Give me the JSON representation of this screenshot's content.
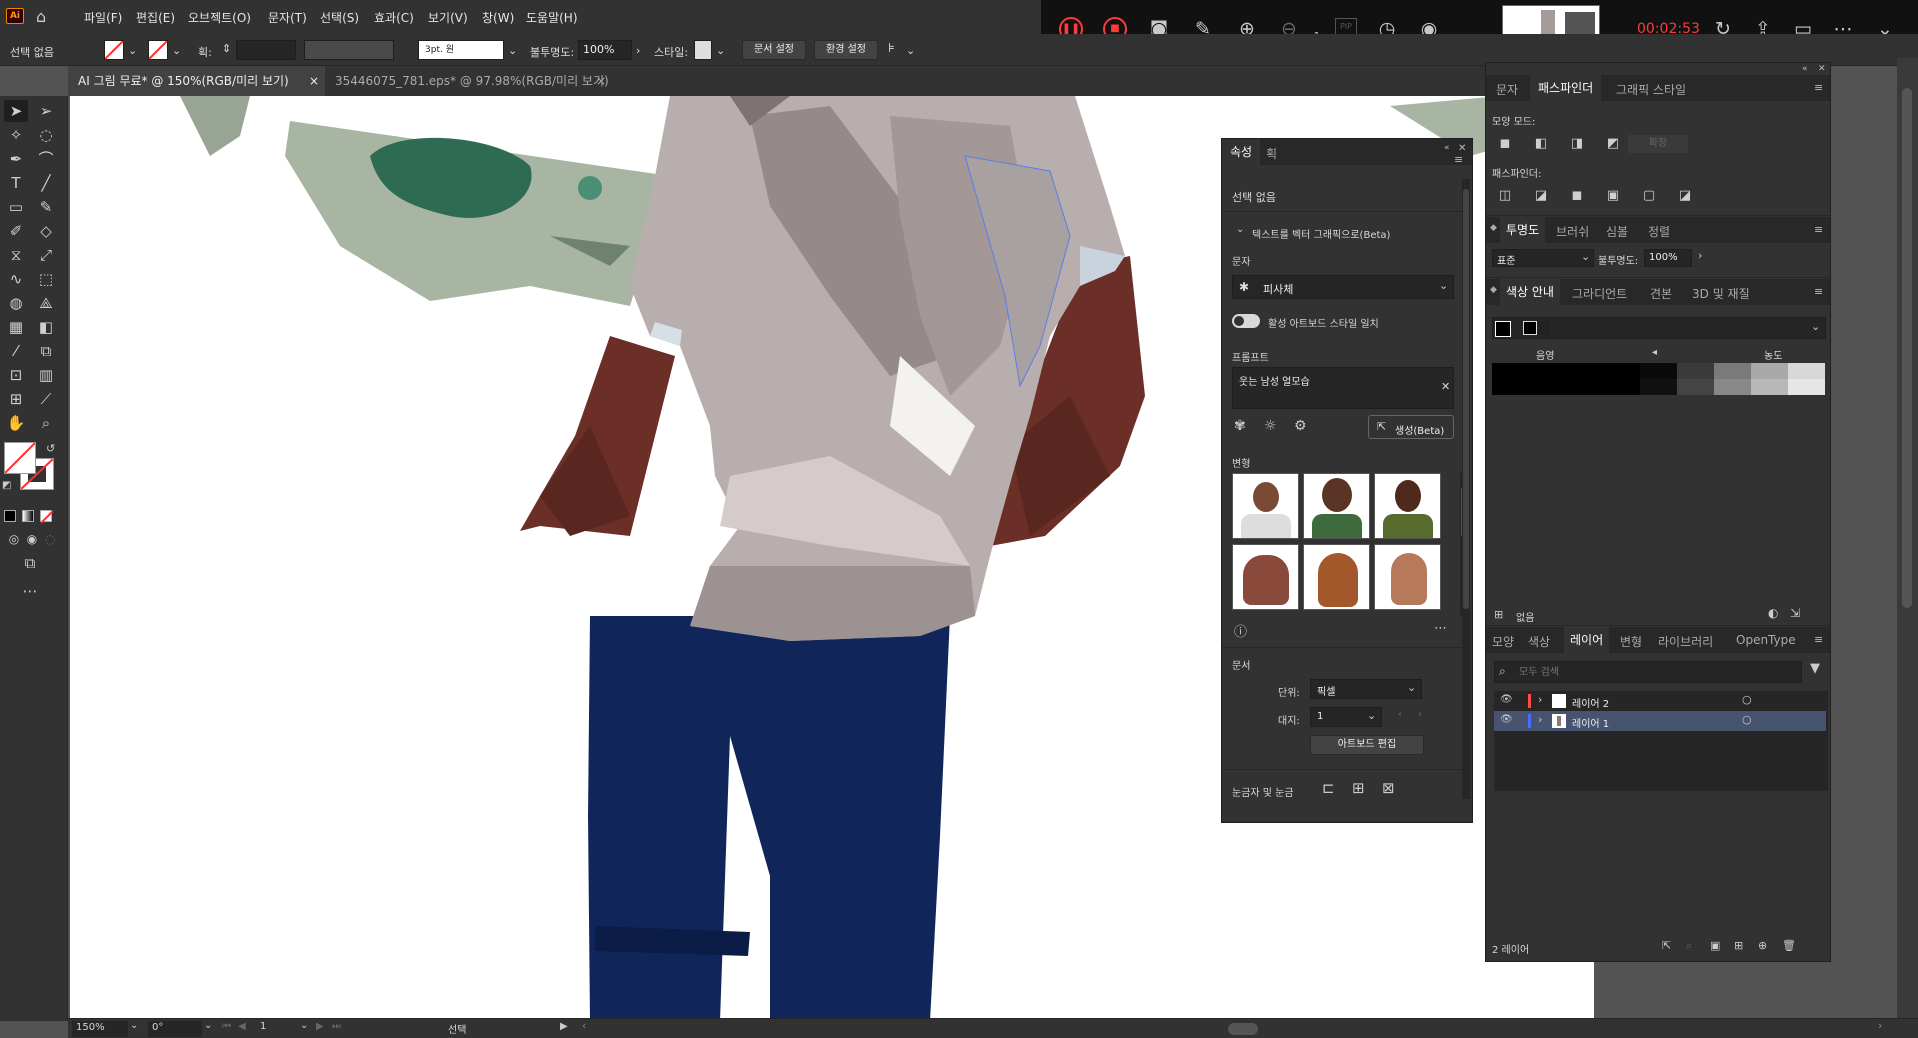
{
  "app": {
    "logo": "Ai",
    "home_icon": "home-icon"
  },
  "menu": [
    "파일(F)",
    "편집(E)",
    "오브젝트(O)",
    "문자(T)",
    "선택(S)",
    "효과(C)",
    "보기(V)",
    "창(W)",
    "도움말(H)"
  ],
  "recorder": {
    "timer": "00:02:53",
    "zoom_label": "x1",
    "pip_label": "PIP"
  },
  "control": {
    "selection": "선택 없음",
    "stroke_label": "획:",
    "stroke_style": "3pt. 원",
    "opacity_label": "불투명도:",
    "opacity_value": "100%",
    "style_label": "스타일:",
    "doc_setup": "문서 설정",
    "prefs": "환경 설정"
  },
  "tabs": [
    {
      "label": "AI 그림 무료* @ 150%(RGB/미리 보기)",
      "close": "×"
    },
    {
      "label": "35446075_781.eps* @ 97.98%(RGB/미리 보기)",
      "close": "×"
    }
  ],
  "status": {
    "zoom": "150%",
    "angle": "0°",
    "artboard": "1",
    "mode": "선택"
  },
  "properties": {
    "tab_active": "속성",
    "tab_other": "획",
    "no_selection": "선택 없음",
    "vector_section": "텍스트를 벡터 그래픽으로(Beta)",
    "subject_label": "문자",
    "subject_value": "피사체",
    "toggle_label": "활성 아트보드 스타일 일치",
    "prompt_label": "프롬프트",
    "prompt_value": "웃는 남성 얼모습",
    "generate": "생성(Beta)",
    "variations_label": "변형",
    "document_label": "문서",
    "unit_label": "단위:",
    "unit_value": "픽셀",
    "artboard_label": "대지:",
    "artboard_value": "1",
    "edit_artboard": "아트보드 편집",
    "rulers_label": "눈금자 및 눈금"
  },
  "pathfinder": {
    "tabs": [
      "문자",
      "패스파인더",
      "그래픽 스타일"
    ],
    "shape_modes": "모양 모드:",
    "expand": "확장",
    "pathfinders": "패스파인더:"
  },
  "transparency": {
    "tabs": [
      "투명도",
      "브러쉬",
      "심볼",
      "정렬"
    ],
    "blend": "표준",
    "opacity_label": "불투명도:",
    "opacity_value": "100%"
  },
  "color_guide": {
    "tabs": [
      "색상 안내",
      "그라디언트",
      "견본",
      "3D 및 재질"
    ],
    "shade_label": "음영",
    "tint_label": "농도",
    "footer": "없음"
  },
  "layers": {
    "tabs": [
      "모양",
      "색상",
      "레이어",
      "변형",
      "라이브러리",
      "OpenType"
    ],
    "search_placeholder": "모두 검색",
    "items": [
      {
        "name": "레이어 2",
        "color": "#ff4b4b"
      },
      {
        "name": "레이어 1",
        "color": "#4b6bff"
      }
    ],
    "count": "2 레이어"
  },
  "colors": {
    "accent_red": "#ff2d2d",
    "shirt": "#b9aeae",
    "jeans": "#10265a",
    "skin": "#6b2f28",
    "money": "#a9b5a3"
  }
}
